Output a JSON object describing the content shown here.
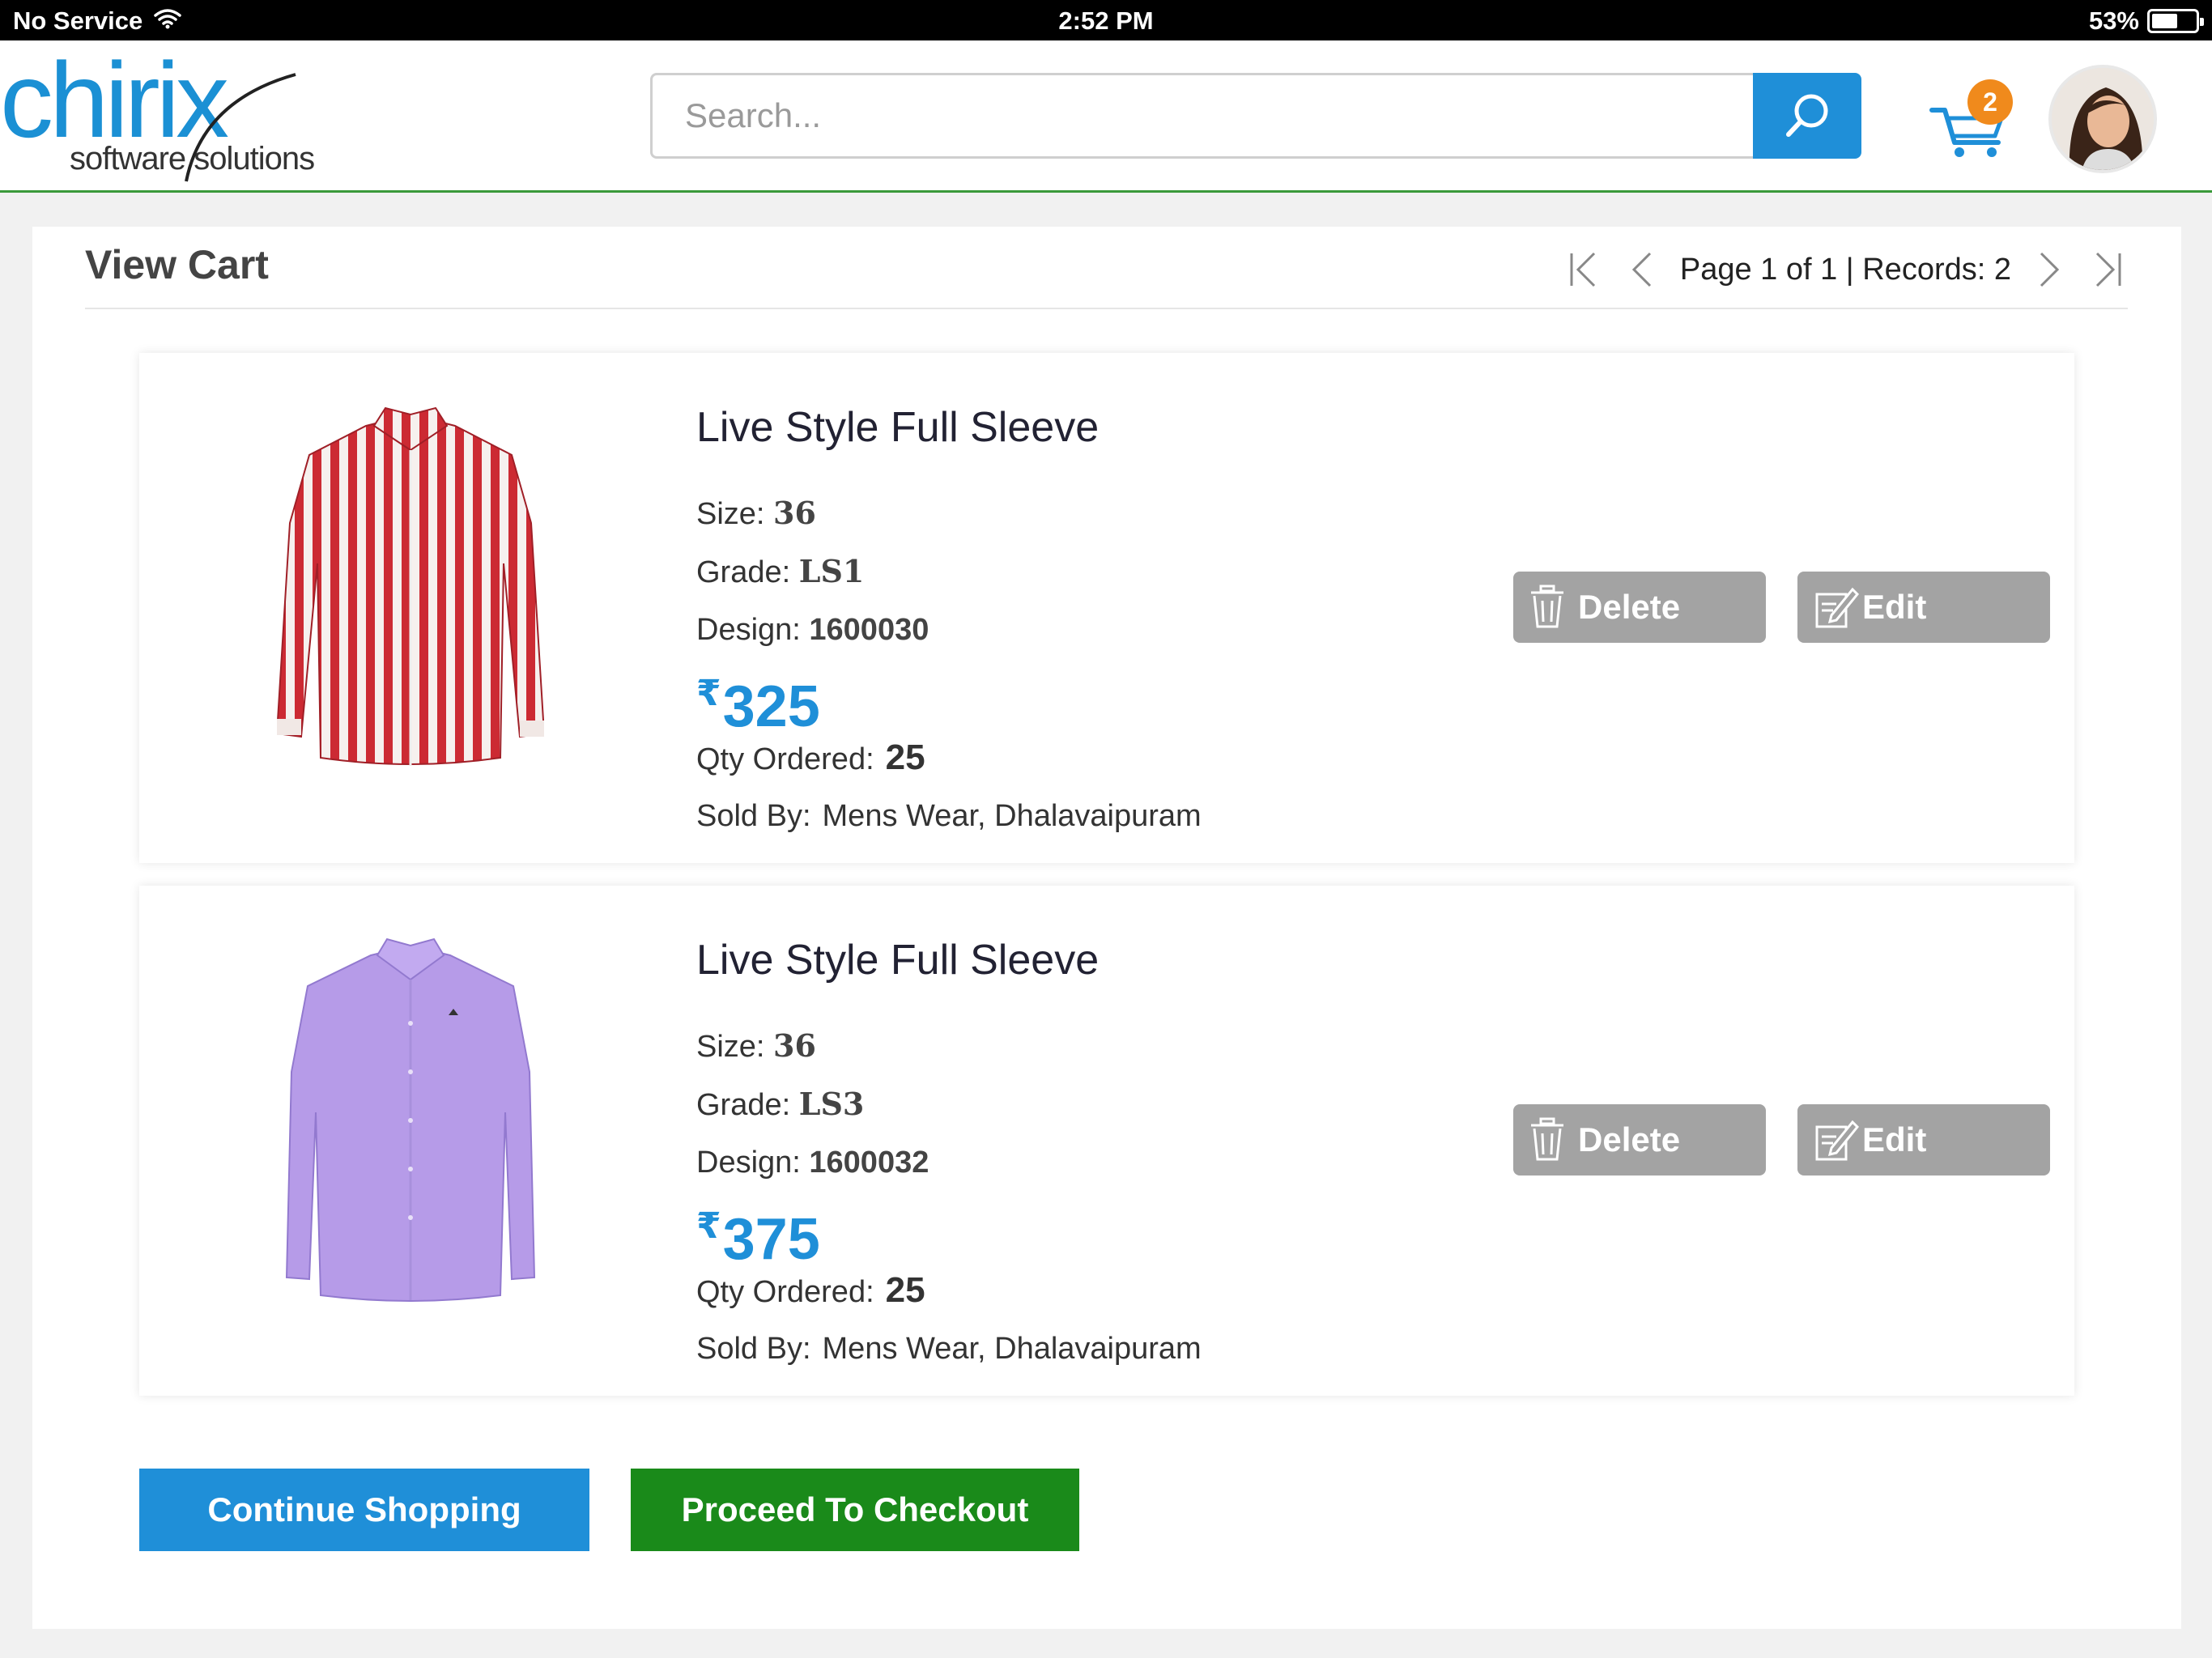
{
  "status_bar": {
    "carrier": "No Service",
    "time": "2:52 PM",
    "battery": "53%"
  },
  "header": {
    "logo_brand": "chirix",
    "logo_tagline": "software solutions",
    "search_placeholder": "Search...",
    "cart_count": "2"
  },
  "page": {
    "title": "View Cart",
    "pagination": "Page 1 of 1 | Records: 2"
  },
  "labels": {
    "size": "Size:",
    "grade": "Grade:",
    "design": "Design:",
    "qty": "Qty Ordered:",
    "sold_by": "Sold By:",
    "currency": "₹",
    "delete": "Delete",
    "edit": "Edit"
  },
  "cart_items": [
    {
      "name": "Live Style Full Sleeve",
      "size": "36",
      "grade": "LS1",
      "design": "1600030",
      "price": "325",
      "qty": "25",
      "sold_by": "Mens Wear, Dhalavaipuram",
      "shirt_color": "#cc2a33"
    },
    {
      "name": "Live Style Full Sleeve",
      "size": "36",
      "grade": "LS3",
      "design": "1600032",
      "price": "375",
      "qty": "25",
      "sold_by": "Mens Wear, Dhalavaipuram",
      "shirt_color": "#b69be8"
    }
  ],
  "actions": {
    "continue": "Continue Shopping",
    "checkout": "Proceed To Checkout"
  },
  "colors": {
    "accent": "#1f8fd8",
    "checkout": "#1a8a1a",
    "badge": "#f08a1c",
    "header_rule": "#3a9a3a"
  }
}
